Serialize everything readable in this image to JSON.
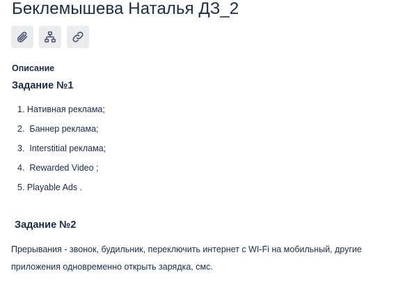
{
  "issue": {
    "title": "Беклемышева Наталья ДЗ_2"
  },
  "toolbar": {
    "buttons": [
      {
        "icon": "paperclip-icon"
      },
      {
        "icon": "hierarchy-icon"
      },
      {
        "icon": "link-icon"
      }
    ]
  },
  "description": {
    "label": "Описание",
    "task1": {
      "heading": "Задание №1",
      "items": [
        {
          "num": "1.",
          "text": " Нативная реклама;"
        },
        {
          "num": "2.",
          "text": "  Баннер реклама;"
        },
        {
          "num": "3.",
          "text": "  Interstitial реклама;"
        },
        {
          "num": "4.",
          "text": "  Rewarded Video ;"
        },
        {
          "num": "5.",
          "text": " Playable Ads ."
        }
      ]
    },
    "task2": {
      "heading": "Задание №2",
      "text": "Прерывания - звонок, будильник, переключить интернет с WI-Fi на мобильный, другие приложения одновременно открыть зарядка, смс."
    }
  },
  "colors": {
    "text": "#172b4d",
    "button_bg": "#ebecf0",
    "icon": "#42526e"
  }
}
